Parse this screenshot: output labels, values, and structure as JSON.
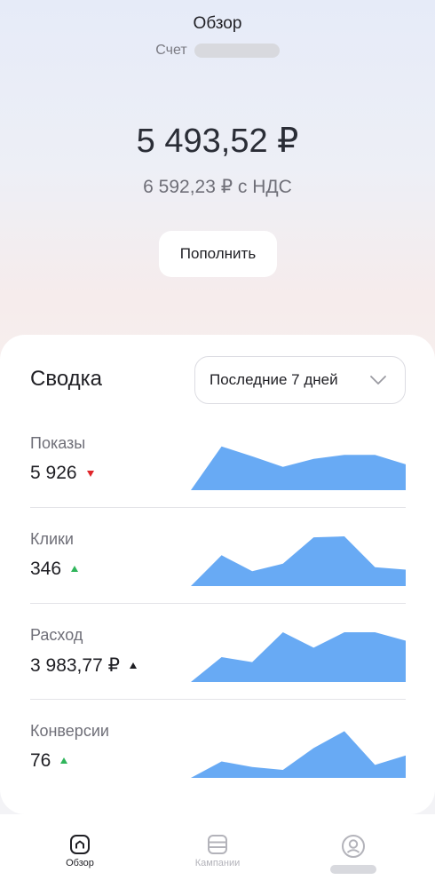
{
  "header": {
    "title": "Обзор",
    "account_label": "Счет"
  },
  "balance": {
    "amount": "5 493,52 ₽",
    "with_vat": "6 592,23 ₽ с НДС",
    "topup_label": "Пополнить"
  },
  "summary": {
    "title": "Сводка",
    "period": "Последние 7 дней",
    "metrics": [
      {
        "label": "Показы",
        "value": "5 926",
        "trend": "down",
        "trend_color": "#e0262a",
        "series": [
          0,
          0.88,
          0.68,
          0.47,
          0.63,
          0.71,
          0.71,
          0.52
        ]
      },
      {
        "label": "Клики",
        "value": "346",
        "trend": "up",
        "trend_color": "#2fb55b",
        "series": [
          0,
          0.62,
          0.3,
          0.45,
          0.98,
          1.0,
          0.38,
          0.33
        ]
      },
      {
        "label": "Расход",
        "value": "3 983,77 ₽",
        "trend": "up",
        "trend_color": "#1f1f24",
        "series": [
          0,
          0.5,
          0.4,
          1.0,
          0.69,
          1.0,
          1.0,
          0.83
        ]
      },
      {
        "label": "Конверсии",
        "value": "76",
        "trend": "up",
        "trend_color": "#2fb55b",
        "series": [
          0,
          0.33,
          0.22,
          0.16,
          0.6,
          0.94,
          0.26,
          0.45
        ]
      }
    ]
  },
  "tabbar": {
    "tabs": [
      {
        "label": "Обзор",
        "icon": "home-icon",
        "active": true
      },
      {
        "label": "Кампании",
        "icon": "campaigns-icon",
        "active": false
      },
      {
        "label": "",
        "icon": "profile-icon",
        "active": false
      }
    ]
  }
}
